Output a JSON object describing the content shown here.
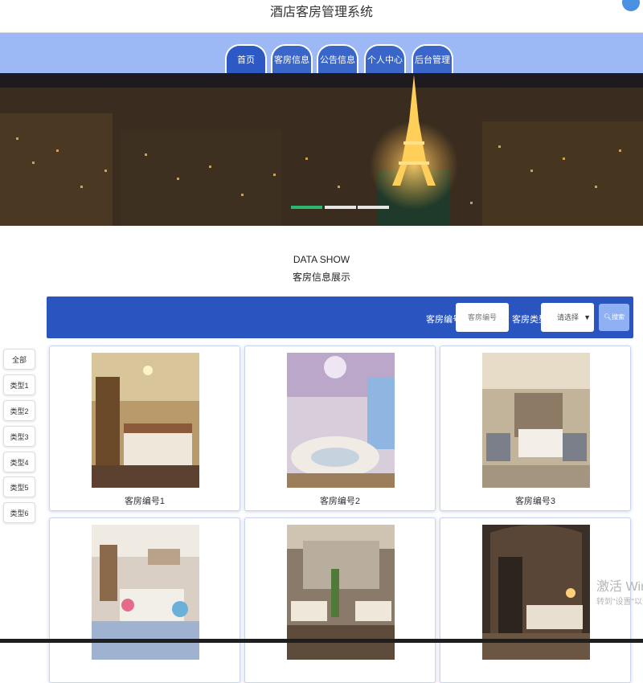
{
  "header": {
    "title": "酒店客房管理系统"
  },
  "nav": {
    "tabs": [
      {
        "label": "首页",
        "active": true
      },
      {
        "label": "客房信息",
        "active": false
      },
      {
        "label": "公告信息",
        "active": false
      },
      {
        "label": "个人中心",
        "active": false
      },
      {
        "label": "后台管理",
        "active": false
      }
    ]
  },
  "banner": {
    "slide_count": 3,
    "active_slide": 1
  },
  "section": {
    "title_en": "DATA SHOW",
    "title_cn": "客房信息展示"
  },
  "search": {
    "room_number_label": "客房编号",
    "room_number_placeholder": "客房编号",
    "room_type_label": "客房类型",
    "room_type_selected": "请选择",
    "search_button_label": "搜索"
  },
  "categories": [
    "全部",
    "类型1",
    "类型2",
    "类型3",
    "类型4",
    "类型5",
    "类型6"
  ],
  "rooms": [
    {
      "caption": "客房编号1"
    },
    {
      "caption": "客房编号2"
    },
    {
      "caption": "客房编号3"
    },
    {
      "caption": ""
    },
    {
      "caption": ""
    },
    {
      "caption": ""
    }
  ],
  "watermark": {
    "line1": "激活 Windo",
    "line2": "转到\"设置\"以激活"
  },
  "colors": {
    "nav_bg": "#9cb8f5",
    "tab_bg": "#3a65c9",
    "search_bg": "#2a55c1",
    "slide_active": "#2fb56f"
  }
}
